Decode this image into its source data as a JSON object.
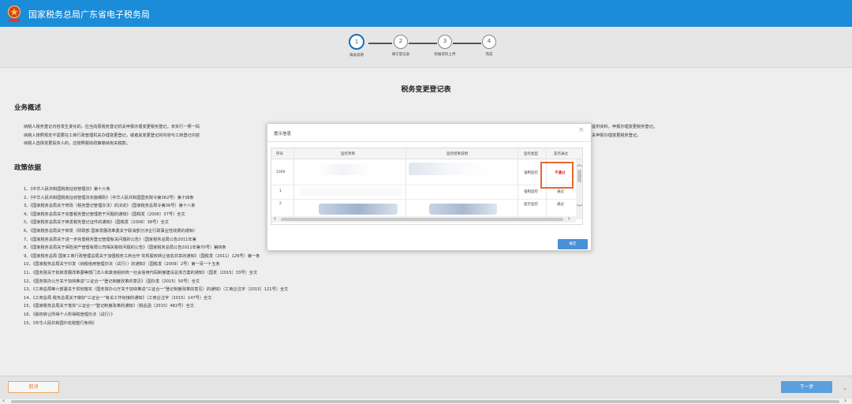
{
  "header": {
    "title": "国家税务总局广东省电子税务局"
  },
  "steps": [
    {
      "num": "1",
      "label": "填表说明",
      "active": true
    },
    {
      "num": "2",
      "label": "填写登记表",
      "active": false
    },
    {
      "num": "3",
      "label": "附报资料上传",
      "active": false
    },
    {
      "num": "4",
      "label": "完成",
      "active": false
    }
  ],
  "main": {
    "form_title": "税务变更登记表",
    "overview_title": "业务概述",
    "overview_lines": [
      "纳税人税务登记内容发生变化的，应当向原税务登记机关申报办理变更税务登记。未实行一照一码",
      "纳税人按照规定不需要在工商行政管理机关办理变更登记，或者其变更登记的内容与工商登记内容",
      "纳税人选择变更投资人的，应按照税收政策缴纳有关税款。"
    ],
    "overview_right_lines": [
      "提供资料，申报办理变更税务登记。",
      "关申报办理变更税务登记。"
    ],
    "policy_title": "政策依据",
    "policies": [
      "1、《中华人民共和国税收征收管理法》第十六条",
      "2、《中华人民共和国税收征收管理法实施细则》（中华人民共和国国务院令第362号）第十四条",
      "3、《国家税务总局关于修改〈税务登记管理办法〉的决定》（国家税务总局令第36号）第十八条",
      "4、《国家税务总局关于完善税务登记管理若干问题的通知》（国税发〔2006〕37号）全文",
      "5、《国家税务总局关于换发税务登记证件的通知》（国税发〔2006〕38号）全文",
      "6、《国家税务总局关于转发〈财政部 国家发展改革委关于取消部分涉企行政事业性收费的通知〉",
      "7、《国家税务总局关于进一步完善税务登记管理有关问题的公告》（国家税务总局公告2011年第",
      "8、《国家税务总局关于保险资产管理有限公司相关税收问题的公告》（国家税务总局公告2011年第70号）第四条",
      "9、《国家税务总局 国家工商行政管理总局关于加强税务工商合作 实现股权转让信息共享的通知》（国税发〔2011〕126号）第一条",
      "10、《国家税务总局关于印发〈纳税信用管理办法（试行）〉的通知》（国税发〔2009〕2号）第一百一十五条",
      "11、《国务院关于批转发展改革委等部门法人和其他组织统一社会信用代码制度建设总体方案的通知》（国发〔2015〕33号）全文",
      "12、《国务院办公厅关于加快推进\"三证合一\"登记制度改革的意见》（国办发〔2015〕50号）全文",
      "13、《工商总局等六部委关于贯彻落实〈国务院办公厅关于加快推进\"三证合一\"登记制度改革的意见〉的通知》（工商企注字〔2015〕121号）全文",
      "14、《工商总局 税务总局关于做好\"三证合一\"有关工作衔接的通知》（工商企注字〔2015〕147号）全文",
      "15、《国家税务总局关于落实\"三证合一\"登记制度改革的通知》（税总函〔2015〕482号）全文",
      "16、《股权转让所得个人所得税管理办法（试行）》",
      "15、《中华人民共和国印花税暂行条例》"
    ]
  },
  "dialog": {
    "title": "提示信息",
    "close": "×",
    "columns": [
      "序号",
      "监控项目",
      "监控结果说明",
      "监控类型",
      "是否通过"
    ],
    "rows": [
      {
        "seq": "1000",
        "item": "",
        "desc": "",
        "type": "强制监控",
        "pass": "不通过",
        "failed": true
      },
      {
        "seq": "1",
        "item": "",
        "desc": "",
        "type": "强制监控",
        "pass": "通过",
        "failed": false
      },
      {
        "seq": "2",
        "item": "",
        "desc": "",
        "type": "提示监控",
        "pass": "通过",
        "failed": false
      }
    ],
    "confirm_label": "确定",
    "highlight_color": "#e8652f"
  },
  "footer": {
    "cancel_label": "取消",
    "next_label": "下一步"
  },
  "colors": {
    "topbar": "#1a8cd8",
    "fail_text": "#e02020",
    "primary_button": "#5b9fdc",
    "cancel_border": "#e8a868"
  },
  "icons": {
    "emblem": "tax-emblem-icon"
  }
}
